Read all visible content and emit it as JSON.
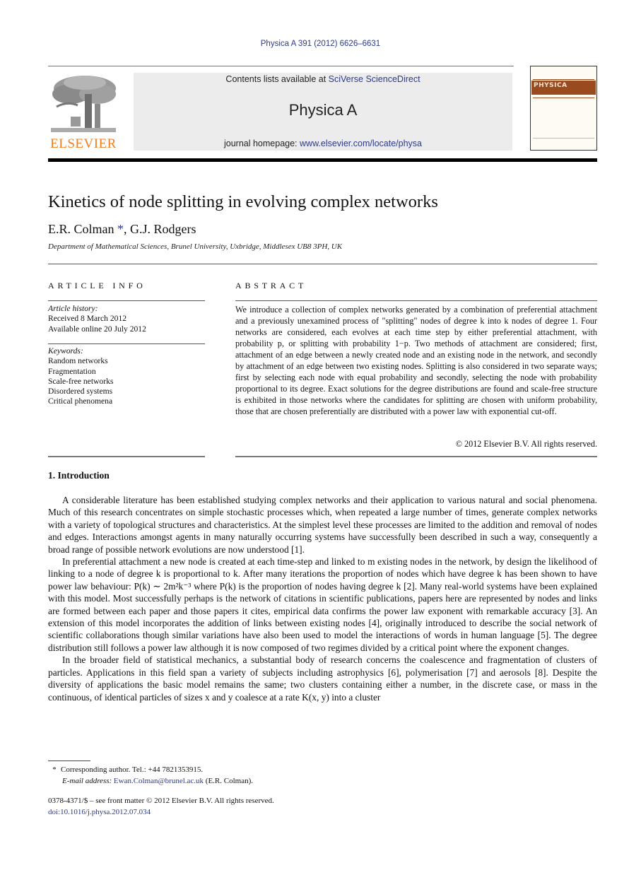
{
  "running_head": "Physica A 391 (2012) 6626–6631",
  "masthead": {
    "contents_prefix": "Contents lists available at ",
    "contents_link": "SciVerse ScienceDirect",
    "journal_name": "Physica A",
    "homepage_prefix": "journal homepage: ",
    "homepage_link": "www.elsevier.com/locate/physa",
    "publisher_logo_text": "ELSEVIER",
    "cover_title": "PHYSICA"
  },
  "colors": {
    "link": "#2b3a8a",
    "publisher_orange": "#f07d1e",
    "cover_band": "#9a4a1f"
  },
  "article": {
    "title": "Kinetics of node splitting in evolving complex networks",
    "authors": [
      {
        "name": "E.R. Colman",
        "mark": "*"
      },
      {
        "name": "G.J. Rodgers",
        "mark": ""
      }
    ],
    "author_separator": ", ",
    "affiliation": "Department of Mathematical Sciences, Brunel University, Uxbridge, Middlesex UB8 3PH, UK"
  },
  "article_info": {
    "heading": "ARTICLE INFO",
    "history_label": "Article history:",
    "received": "Received 8 March 2012",
    "available_online": "Available online 20 July 2012",
    "keywords_label": "Keywords:",
    "keywords": [
      "Random networks",
      "Fragmentation",
      "Scale-free networks",
      "Disordered systems",
      "Critical phenomena"
    ]
  },
  "abstract": {
    "heading": "ABSTRACT",
    "text": "We introduce a collection of complex networks generated by a combination of preferential attachment and a previously unexamined process of \"splitting\" nodes of degree k into k nodes of degree 1. Four networks are considered, each evolves at each time step by either preferential attachment, with probability p, or splitting with probability 1−p. Two methods of attachment are considered; first, attachment of an edge between a newly created node and an existing node in the network, and secondly by attachment of an edge between two existing nodes. Splitting is also considered in two separate ways; first by selecting each node with equal probability and secondly, selecting the node with probability proportional to its degree. Exact solutions for the degree distributions are found and scale-free structure is exhibited in those networks where the candidates for splitting are chosen with uniform probability, those that are chosen preferentially are distributed with a power law with exponential cut-off.",
    "copyright": "© 2012 Elsevier B.V. All rights reserved."
  },
  "introduction": {
    "heading": "1.  Introduction",
    "paragraphs": [
      "A considerable literature has been established studying complex networks and their application to various natural and social phenomena. Much of this research concentrates on simple stochastic processes which, when repeated a large number of times, generate complex networks with a variety of topological structures and characteristics. At the simplest level these processes are limited to the addition and removal of nodes and edges. Interactions amongst agents in many naturally occurring systems have successfully been described in such a way, consequently a broad range of possible network evolutions are now understood [1].",
      "In preferential attachment a new node is created at each time-step and linked to m existing nodes in the network, by design the likelihood of linking to a node of degree k is proportional to k. After many iterations the proportion of nodes which have degree k has been shown to have power law behaviour: P(k) ∼ 2m²k⁻³ where P(k) is the proportion of nodes having degree k [2]. Many real-world systems have been explained with this model. Most successfully perhaps is the network of citations in scientific publications, papers here are represented by nodes and links are formed between each paper and those papers it cites, empirical data confirms the power law exponent with remarkable accuracy [3]. An extension of this model incorporates the addition of links between existing nodes [4], originally introduced to describe the social network of scientific collaborations though similar variations have also been used to model the interactions of words in human language [5]. The degree distribution still follows a power law although it is now composed of two regimes divided by a critical point where the exponent changes.",
      "In the broader field of statistical mechanics, a substantial body of research concerns the coalescence and fragmentation of clusters of particles. Applications in this field span a variety of subjects including astrophysics [6], polymerisation [7] and aerosols [8]. Despite the diversity of applications the basic model remains the same; two clusters containing either a number, in the discrete case, or mass in the continuous, of identical particles of sizes x and y coalesce at a rate K(x, y) into a cluster"
    ]
  },
  "footnote": {
    "mark": "*",
    "corresponding": "Corresponding author. Tel.: +44 7821353915.",
    "email_label": "E-mail address: ",
    "email": "Ewan.Colman@brunel.ac.uk",
    "email_suffix": " (E.R. Colman).",
    "front_matter": "0378-4371/$ – see front matter © 2012 Elsevier B.V. All rights reserved.",
    "doi": "doi:10.1016/j.physa.2012.07.034"
  }
}
